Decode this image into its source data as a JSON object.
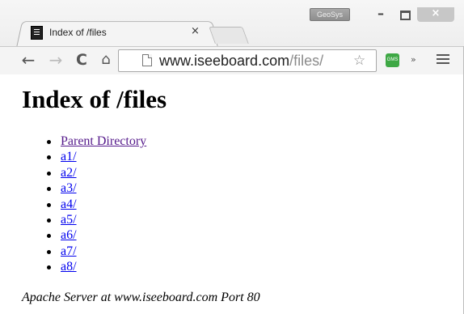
{
  "window": {
    "profile_name": "GeoSys",
    "controls": {
      "minimize": "–",
      "maximize": "",
      "close": "×"
    }
  },
  "tab": {
    "title": "Index of /files",
    "close": "×"
  },
  "toolbar": {
    "back": "←",
    "forward": "→",
    "reload": "C",
    "home": "⌂",
    "url_host": "www.iseeboard.com",
    "url_path": "/files/",
    "star": "☆",
    "extension_label": "GMS",
    "overflow": "»"
  },
  "page": {
    "heading": "Index of /files",
    "links": [
      {
        "label": "Parent Directory",
        "visited": true
      },
      {
        "label": "a1/",
        "visited": false
      },
      {
        "label": "a2/",
        "visited": false
      },
      {
        "label": "a3/",
        "visited": false
      },
      {
        "label": "a4/",
        "visited": false
      },
      {
        "label": "a5/",
        "visited": false
      },
      {
        "label": "a6/",
        "visited": false
      },
      {
        "label": "a7/",
        "visited": false
      },
      {
        "label": "a8/",
        "visited": false
      }
    ],
    "footer": "Apache Server at www.iseeboard.com Port 80"
  },
  "colors": {
    "link_visited": "#551a8b",
    "link_unvisited": "#0000ee",
    "extension_green": "#3ea845"
  }
}
